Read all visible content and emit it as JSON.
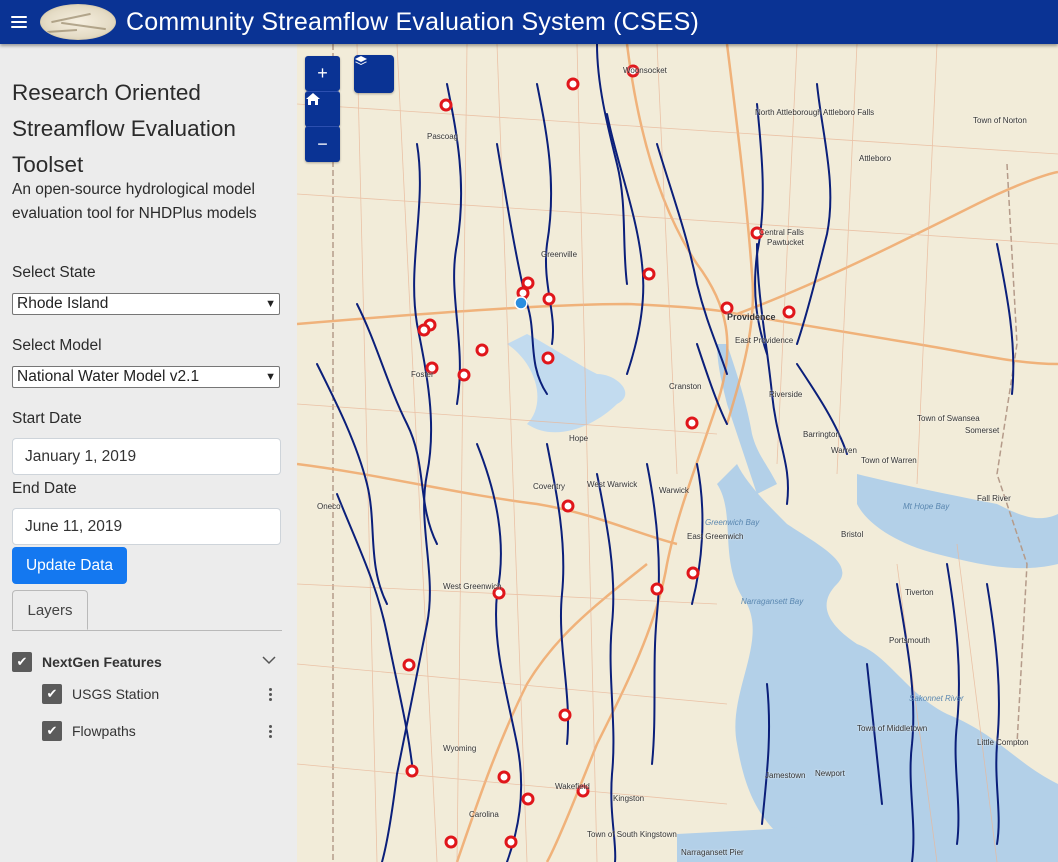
{
  "header": {
    "title": "Community Streamflow Evaluation System (CSES)"
  },
  "sidebar": {
    "title": "Research Oriented Streamflow Evaluation Toolset",
    "description": "An open-source hydrological model evaluation tool for NHDPlus models",
    "state_label": "Select State",
    "state_value": "Rhode Island",
    "model_label": "Select Model",
    "model_value": "National Water Model v2.1",
    "start_label": "Start Date",
    "start_value": "January 1, 2019",
    "end_label": "End Date",
    "end_value": "June 11, 2019",
    "update_button": "Update Data",
    "tab_label": "Layers",
    "layers": {
      "group_label": "NextGen Features",
      "items": [
        {
          "label": "USGS Station",
          "checked": true
        },
        {
          "label": "Flowpaths",
          "checked": true
        }
      ]
    }
  },
  "map": {
    "controls": {
      "zoom_in": "+",
      "zoom_out": "−",
      "home_icon": "home-icon",
      "layers_icon": "layers-icon"
    },
    "place_labels": [
      "Woonsocket",
      "Pascoag",
      "Greenville",
      "Providence",
      "East Providence",
      "Central Falls",
      "Pawtucket",
      "North Attleborough",
      "Attleboro Falls",
      "Attleboro",
      "Town of Norton",
      "Cranston",
      "Riverside",
      "Barrington",
      "Warren",
      "Town of Warren",
      "Town of Swansea",
      "Somerset",
      "Fall River",
      "Bristol",
      "Tiverton",
      "Portsmouth",
      "Town of Middletown",
      "Newport",
      "Jamestown",
      "Little Compton",
      "Warwick",
      "West Warwick",
      "Coventry",
      "Hope",
      "Foster",
      "Oneco",
      "East Greenwich",
      "West Greenwich",
      "Wyoming",
      "Carolina",
      "Kingston",
      "Wakefield",
      "Town of South Kingstown",
      "Narragansett Pier",
      "Narragansett Bay",
      "Greenwich Bay",
      "Mt Hope Bay",
      "Sakonnet River"
    ],
    "colors": {
      "land": "#f2ecd9",
      "water": "#b3d0e8",
      "flowpath": "#0b1f7a",
      "station": "#e0161b",
      "selected_station": "#2a8ee0"
    }
  }
}
